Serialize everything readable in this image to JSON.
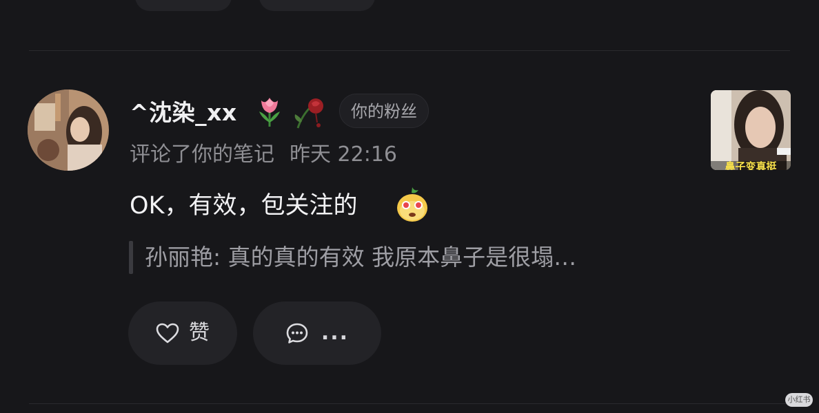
{
  "top_actions": {
    "like_label": "",
    "reply_label": ""
  },
  "comment": {
    "username": "^沈染_xx",
    "user_emojis": [
      "tulip-emoji",
      "wilted-rose-emoji"
    ],
    "fan_badge": "你的粉丝",
    "action_text": "评论了你的笔记",
    "timestamp": "昨天 22:16",
    "text": "OK，有效，包关注的",
    "text_emoji": "pudding-face-emoji",
    "quote": "孙丽艳: 真的真的有效 我原本鼻子是很塌…",
    "like_label": "赞",
    "reply_label": "...",
    "note_thumbnail_caption": "鼻子变真挺"
  },
  "watermark": "小红书",
  "icons": {
    "like": "heart-outline-icon",
    "reply": "chat-bubble-icon"
  },
  "colors": {
    "background": "#17171a",
    "button_bg": "#232327",
    "primary_text": "#f0f0f2",
    "secondary_text": "#8f8f94",
    "quote_text": "#9e9ea4"
  }
}
